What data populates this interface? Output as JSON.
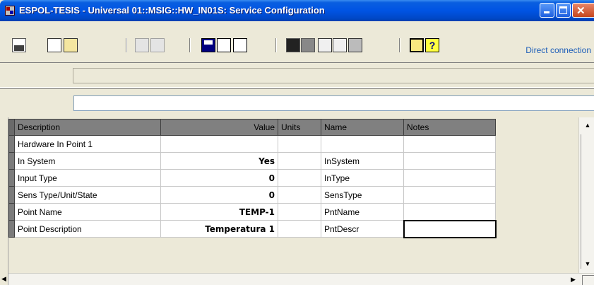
{
  "window": {
    "title": "ESPOL-TESIS - Universal 01::MSIG::HW_IN01S: Service Configuration"
  },
  "toolbar": {
    "icons": [
      "printer-icon",
      "copy-icon",
      "paste-icon",
      "bolt-icon",
      "no-connect-icon",
      "save-icon",
      "sort-ascending-icon",
      "sort-descending-icon",
      "camera-icon",
      "eye-icon",
      "tool-icon",
      "tool-icon",
      "gears-icon",
      "window-icon",
      "help-icon"
    ],
    "help_glyph": "?",
    "connection_status": "Direct connection"
  },
  "status": {
    "field_value": ""
  },
  "address": {
    "field_value": ""
  },
  "grid": {
    "columns": [
      {
        "key": "description",
        "label": "Description"
      },
      {
        "key": "value",
        "label": "Value"
      },
      {
        "key": "units",
        "label": "Units"
      },
      {
        "key": "name",
        "label": "Name"
      },
      {
        "key": "notes",
        "label": "Notes"
      }
    ],
    "rows": [
      {
        "description": "Hardware In Point 1",
        "value": "",
        "units": "",
        "name": "",
        "notes": ""
      },
      {
        "description": "In System",
        "value": "Yes",
        "units": "",
        "name": "InSystem",
        "notes": ""
      },
      {
        "description": "Input Type",
        "value": "0",
        "units": "",
        "name": "InType",
        "notes": ""
      },
      {
        "description": "Sens Type/Unit/State",
        "value": "0",
        "units": "",
        "name": "SensType",
        "notes": ""
      },
      {
        "description": "Point Name",
        "value": "TEMP-1",
        "units": "",
        "name": "PntName",
        "notes": ""
      },
      {
        "description": "Point Description",
        "value": "Temperatura 1",
        "units": "",
        "name": "PntDescr",
        "notes": ""
      }
    ]
  },
  "colors": {
    "titlebar": "#0054e3",
    "header_bg": "#808080",
    "connection_link": "#1f5fb8"
  }
}
